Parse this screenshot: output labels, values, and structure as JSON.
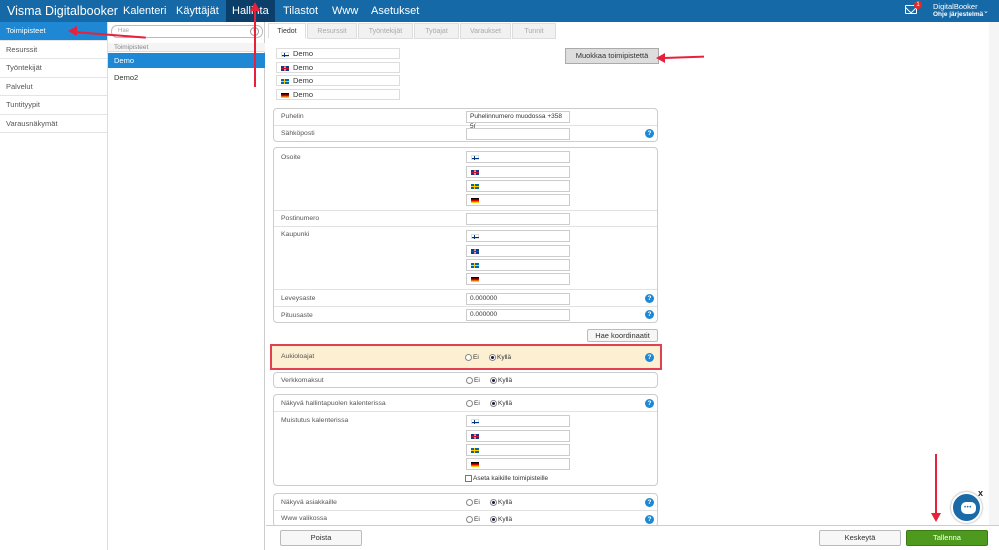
{
  "header": {
    "brand": "Visma Digitalbooker",
    "nav": [
      "Kalenteri",
      "Käyttäjät",
      "Hallinta",
      "Tilastot",
      "Www",
      "Asetukset"
    ],
    "active_nav": "Hallinta",
    "mail_count": "1",
    "account_name": "DigitalBooker",
    "account_sub": "Ohje järjestelmä"
  },
  "sidebar": {
    "items": [
      "Toimipisteet",
      "Resurssit",
      "Työntekijät",
      "Palvelut",
      "Tuntityypit",
      "Varausnäkymät"
    ],
    "active": "Toimipisteet"
  },
  "list": {
    "search_placeholder": "Hae",
    "clear_label": "×",
    "header": "Toimipisteet",
    "items": [
      "Demo",
      "Demo2"
    ]
  },
  "tabs": [
    "Tiedot",
    "Resurssit",
    "Työntekijät",
    "Työajat",
    "Varaukset",
    "Tunnit"
  ],
  "names": [
    "Demo",
    "Demo",
    "Demo",
    "Demo"
  ],
  "edit_button": "Muokkaa toimipistettä",
  "contact": {
    "phone_label": "Puhelin",
    "phone_value": "Puhelinnumero muodossa +358 5(",
    "email_label": "Sähköposti",
    "email_value": ""
  },
  "address": {
    "address_label": "Osoite",
    "postal_label": "Postinumero",
    "city_label": "Kaupunki",
    "lat_label": "Leveysaste",
    "lat_value": "0.000000",
    "lon_label": "Pituusaste",
    "lon_value": "0.000000"
  },
  "coords_button": "Hae koordinaatit",
  "options": {
    "no": "Ei",
    "yes": "Kyllä",
    "open_label": "Aukioloajat",
    "payment_label": "Verkkomaksut",
    "calendar_label": "Näkyvä hallintapuolen kalenterissa",
    "reminder_label": "Muistutus kalenterissa",
    "apply_all_label": "Aseta kaikille toimipisteille",
    "visible_label": "Näkyvä asiakkaille",
    "www_label": "Www valikossa"
  },
  "help_glyph": "?",
  "footer": {
    "delete": "Poista",
    "cancel": "Keskeytä",
    "save": "Tallenna"
  },
  "chat": {
    "close": "x",
    "dots": "•••"
  }
}
